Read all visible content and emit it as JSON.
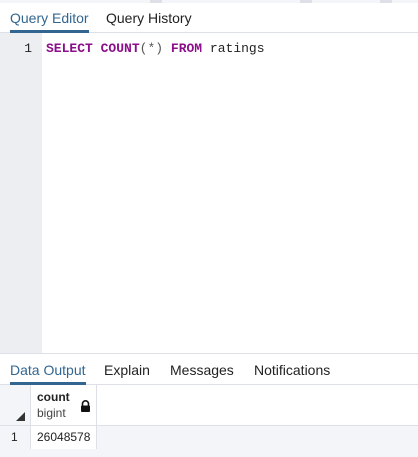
{
  "editor_tabs": [
    {
      "label": "Query Editor",
      "active": true
    },
    {
      "label": "Query History",
      "active": false
    }
  ],
  "editor": {
    "line_number": "1",
    "tokens": {
      "select": "SELECT",
      "count": "COUNT",
      "paren_open": "(",
      "star": "*",
      "paren_close": ")",
      "from": "FROM",
      "table": "ratings"
    }
  },
  "output_tabs": [
    {
      "label": "Data Output",
      "active": true
    },
    {
      "label": "Explain",
      "active": false
    },
    {
      "label": "Messages",
      "active": false
    },
    {
      "label": "Notifications",
      "active": false
    }
  ],
  "result_grid": {
    "columns": [
      {
        "name": "count",
        "type": "bigint",
        "icon": "lock-icon"
      }
    ],
    "rows": [
      {
        "row_number": "1",
        "cells": [
          "26048578"
        ]
      }
    ]
  },
  "colors": {
    "accent": "#326690",
    "keyword": "#8b0e8a",
    "gutter_bg": "#eceef2",
    "grid_bg": "#f3f5f9"
  }
}
